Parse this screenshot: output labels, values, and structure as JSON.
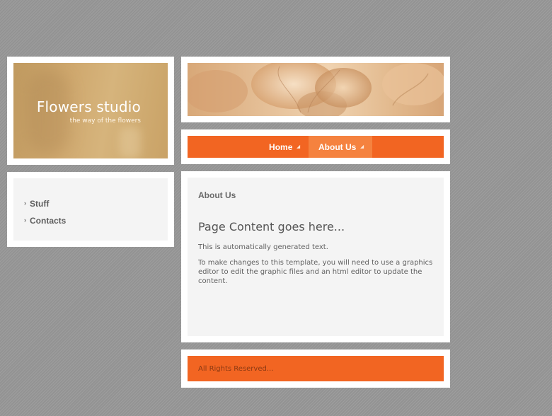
{
  "logo": {
    "title": "Flowers studio",
    "tagline": "the way of the flowers"
  },
  "nav": {
    "items": [
      {
        "label": "Home",
        "active": false
      },
      {
        "label": "About Us",
        "active": true
      }
    ]
  },
  "sidebar": {
    "items": [
      {
        "label": "Stuff"
      },
      {
        "label": "Contacts"
      }
    ]
  },
  "content": {
    "section_heading": "About Us",
    "page_heading": "Page Content goes here...",
    "paragraphs": [
      "This is automatically generated text.",
      "To make changes to this template, you will need to use a graphics editor to edit the graphic files and an html editor to update the content."
    ]
  },
  "footer": {
    "text": "All Rights Reserved..."
  },
  "colors": {
    "accent": "#f26522",
    "accent_active": "#f5823f",
    "panel_bg": "#f4f4f4",
    "page_bg": "#9a9a9a"
  }
}
